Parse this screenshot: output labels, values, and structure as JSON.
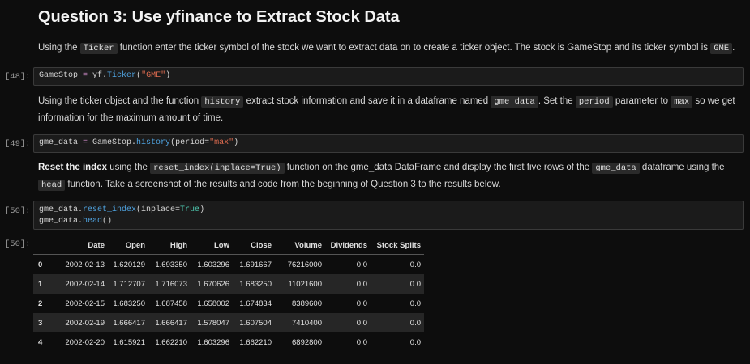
{
  "heading": "Question 3: Use yfinance to Extract Stock Data",
  "para1": {
    "t1": "Using the ",
    "c1": "Ticker",
    "t2": " function enter the ticker symbol of the stock we want to extract data on to create a ticker object. The stock is GameStop and its ticker symbol is ",
    "c2": "GME",
    "t3": "."
  },
  "cell48": {
    "prompt": "[48]:",
    "var": "GameStop",
    "eq": " = ",
    "obj": "yf.",
    "fn": "Ticker",
    "open": "(",
    "arg": "\"GME\"",
    "close": ")"
  },
  "para2": {
    "t1": "Using the ticker object and the function ",
    "c1": "history",
    "t2": " extract stock information and save it in a dataframe named ",
    "c2": "gme_data",
    "t3": ". Set the ",
    "c3": "period",
    "t4": " parameter to ",
    "c4": "max",
    "t5": " so we get information for the maximum amount of time."
  },
  "cell49": {
    "prompt": "[49]:",
    "var": "gme_data",
    "eq": " = ",
    "obj": "GameStop.",
    "fn": "history",
    "open": "(period=",
    "arg": "\"max\"",
    "close": ")"
  },
  "para3": {
    "b1": "Reset the index",
    "t1": " using the ",
    "c1": "reset_index(inplace=True)",
    "t2": " function on the gme_data DataFrame and display the first five rows of the ",
    "c2": "gme_data",
    "t3": " dataframe using the ",
    "c3": "head",
    "t4": " function. Take a screenshot of the results and code from the beginning of Question 3 to the results below."
  },
  "cell50": {
    "prompt": "[50]:",
    "l1_obj": "gme_data.",
    "l1_fn": "reset_index",
    "l1_open": "(inplace=",
    "l1_kw": "True",
    "l1_close": ")",
    "l2_obj": "gme_data.",
    "l2_fn": "head",
    "l2_close": "()"
  },
  "output50": {
    "prompt": "[50]:",
    "columns": [
      "",
      "Date",
      "Open",
      "High",
      "Low",
      "Close",
      "Volume",
      "Dividends",
      "Stock Splits"
    ],
    "rows": [
      [
        "0",
        "2002-02-13",
        "1.620129",
        "1.693350",
        "1.603296",
        "1.691667",
        "76216000",
        "0.0",
        "0.0"
      ],
      [
        "1",
        "2002-02-14",
        "1.712707",
        "1.716073",
        "1.670626",
        "1.683250",
        "11021600",
        "0.0",
        "0.0"
      ],
      [
        "2",
        "2002-02-15",
        "1.683250",
        "1.687458",
        "1.658002",
        "1.674834",
        "8389600",
        "0.0",
        "0.0"
      ],
      [
        "3",
        "2002-02-19",
        "1.666417",
        "1.666417",
        "1.578047",
        "1.607504",
        "7410400",
        "0.0",
        "0.0"
      ],
      [
        "4",
        "2002-02-20",
        "1.615921",
        "1.662210",
        "1.603296",
        "1.662210",
        "6892800",
        "0.0",
        "0.0"
      ]
    ]
  }
}
